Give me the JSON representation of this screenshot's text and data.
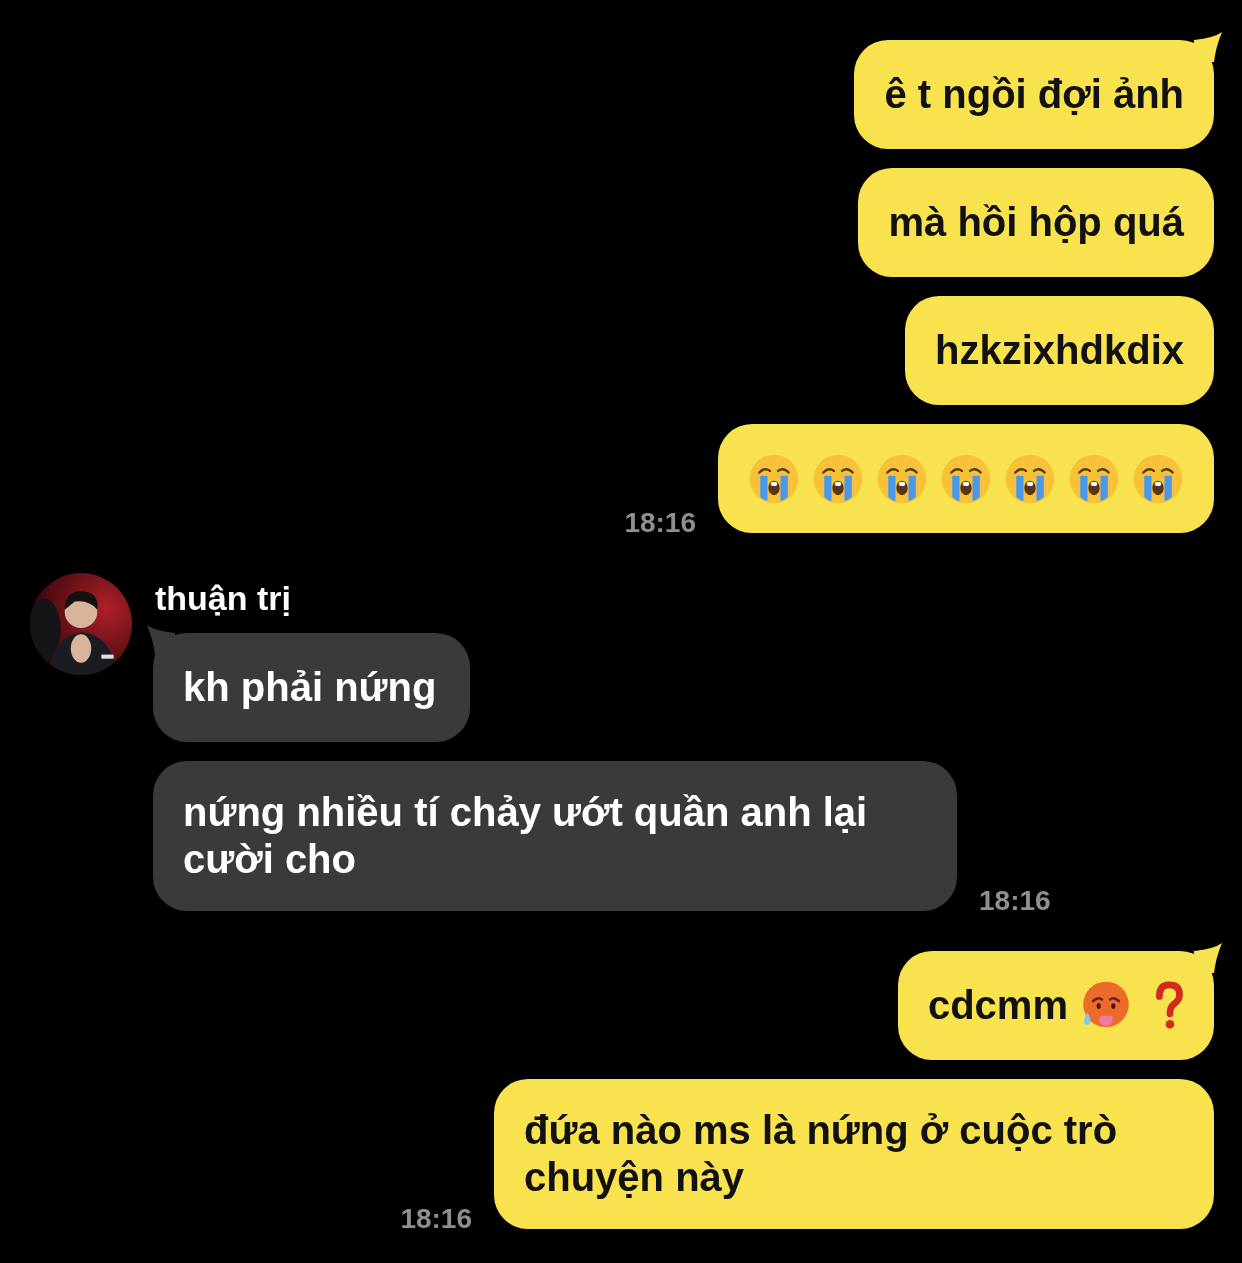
{
  "messages": [
    {
      "kind": "outgoing",
      "time": "18:16",
      "bubbles": [
        {
          "parts": [
            {
              "kind": "text",
              "text": "ê t ngồi đợi ảnh"
            }
          ]
        },
        {
          "parts": [
            {
              "kind": "text",
              "text": "mà hồi hộp quá"
            }
          ]
        },
        {
          "parts": [
            {
              "kind": "text",
              "text": "hzkzixhdkdix"
            }
          ]
        },
        {
          "parts": [
            {
              "kind": "crying-face"
            },
            {
              "kind": "crying-face"
            },
            {
              "kind": "crying-face"
            },
            {
              "kind": "crying-face"
            },
            {
              "kind": "crying-face"
            },
            {
              "kind": "crying-face"
            },
            {
              "kind": "crying-face"
            }
          ]
        }
      ]
    },
    {
      "kind": "incoming",
      "sender": {
        "name": "thuận trị"
      },
      "time": "18:16",
      "bubbles": [
        {
          "parts": [
            {
              "kind": "text",
              "text": "kh phải nứng"
            }
          ]
        },
        {
          "parts": [
            {
              "kind": "text",
              "text": "nứng nhiều tí chảy ướt quần anh lại cười cho"
            }
          ]
        }
      ]
    },
    {
      "kind": "outgoing",
      "time": "18:16",
      "bubbles": [
        {
          "parts": [
            {
              "kind": "text",
              "text": "cdcmm"
            },
            {
              "kind": "hot-face"
            },
            {
              "kind": "question-mark"
            }
          ]
        },
        {
          "parts": [
            {
              "kind": "text",
              "text": "đứa nào ms là nứng ở cuộc trò chuyện này"
            }
          ]
        }
      ]
    }
  ]
}
